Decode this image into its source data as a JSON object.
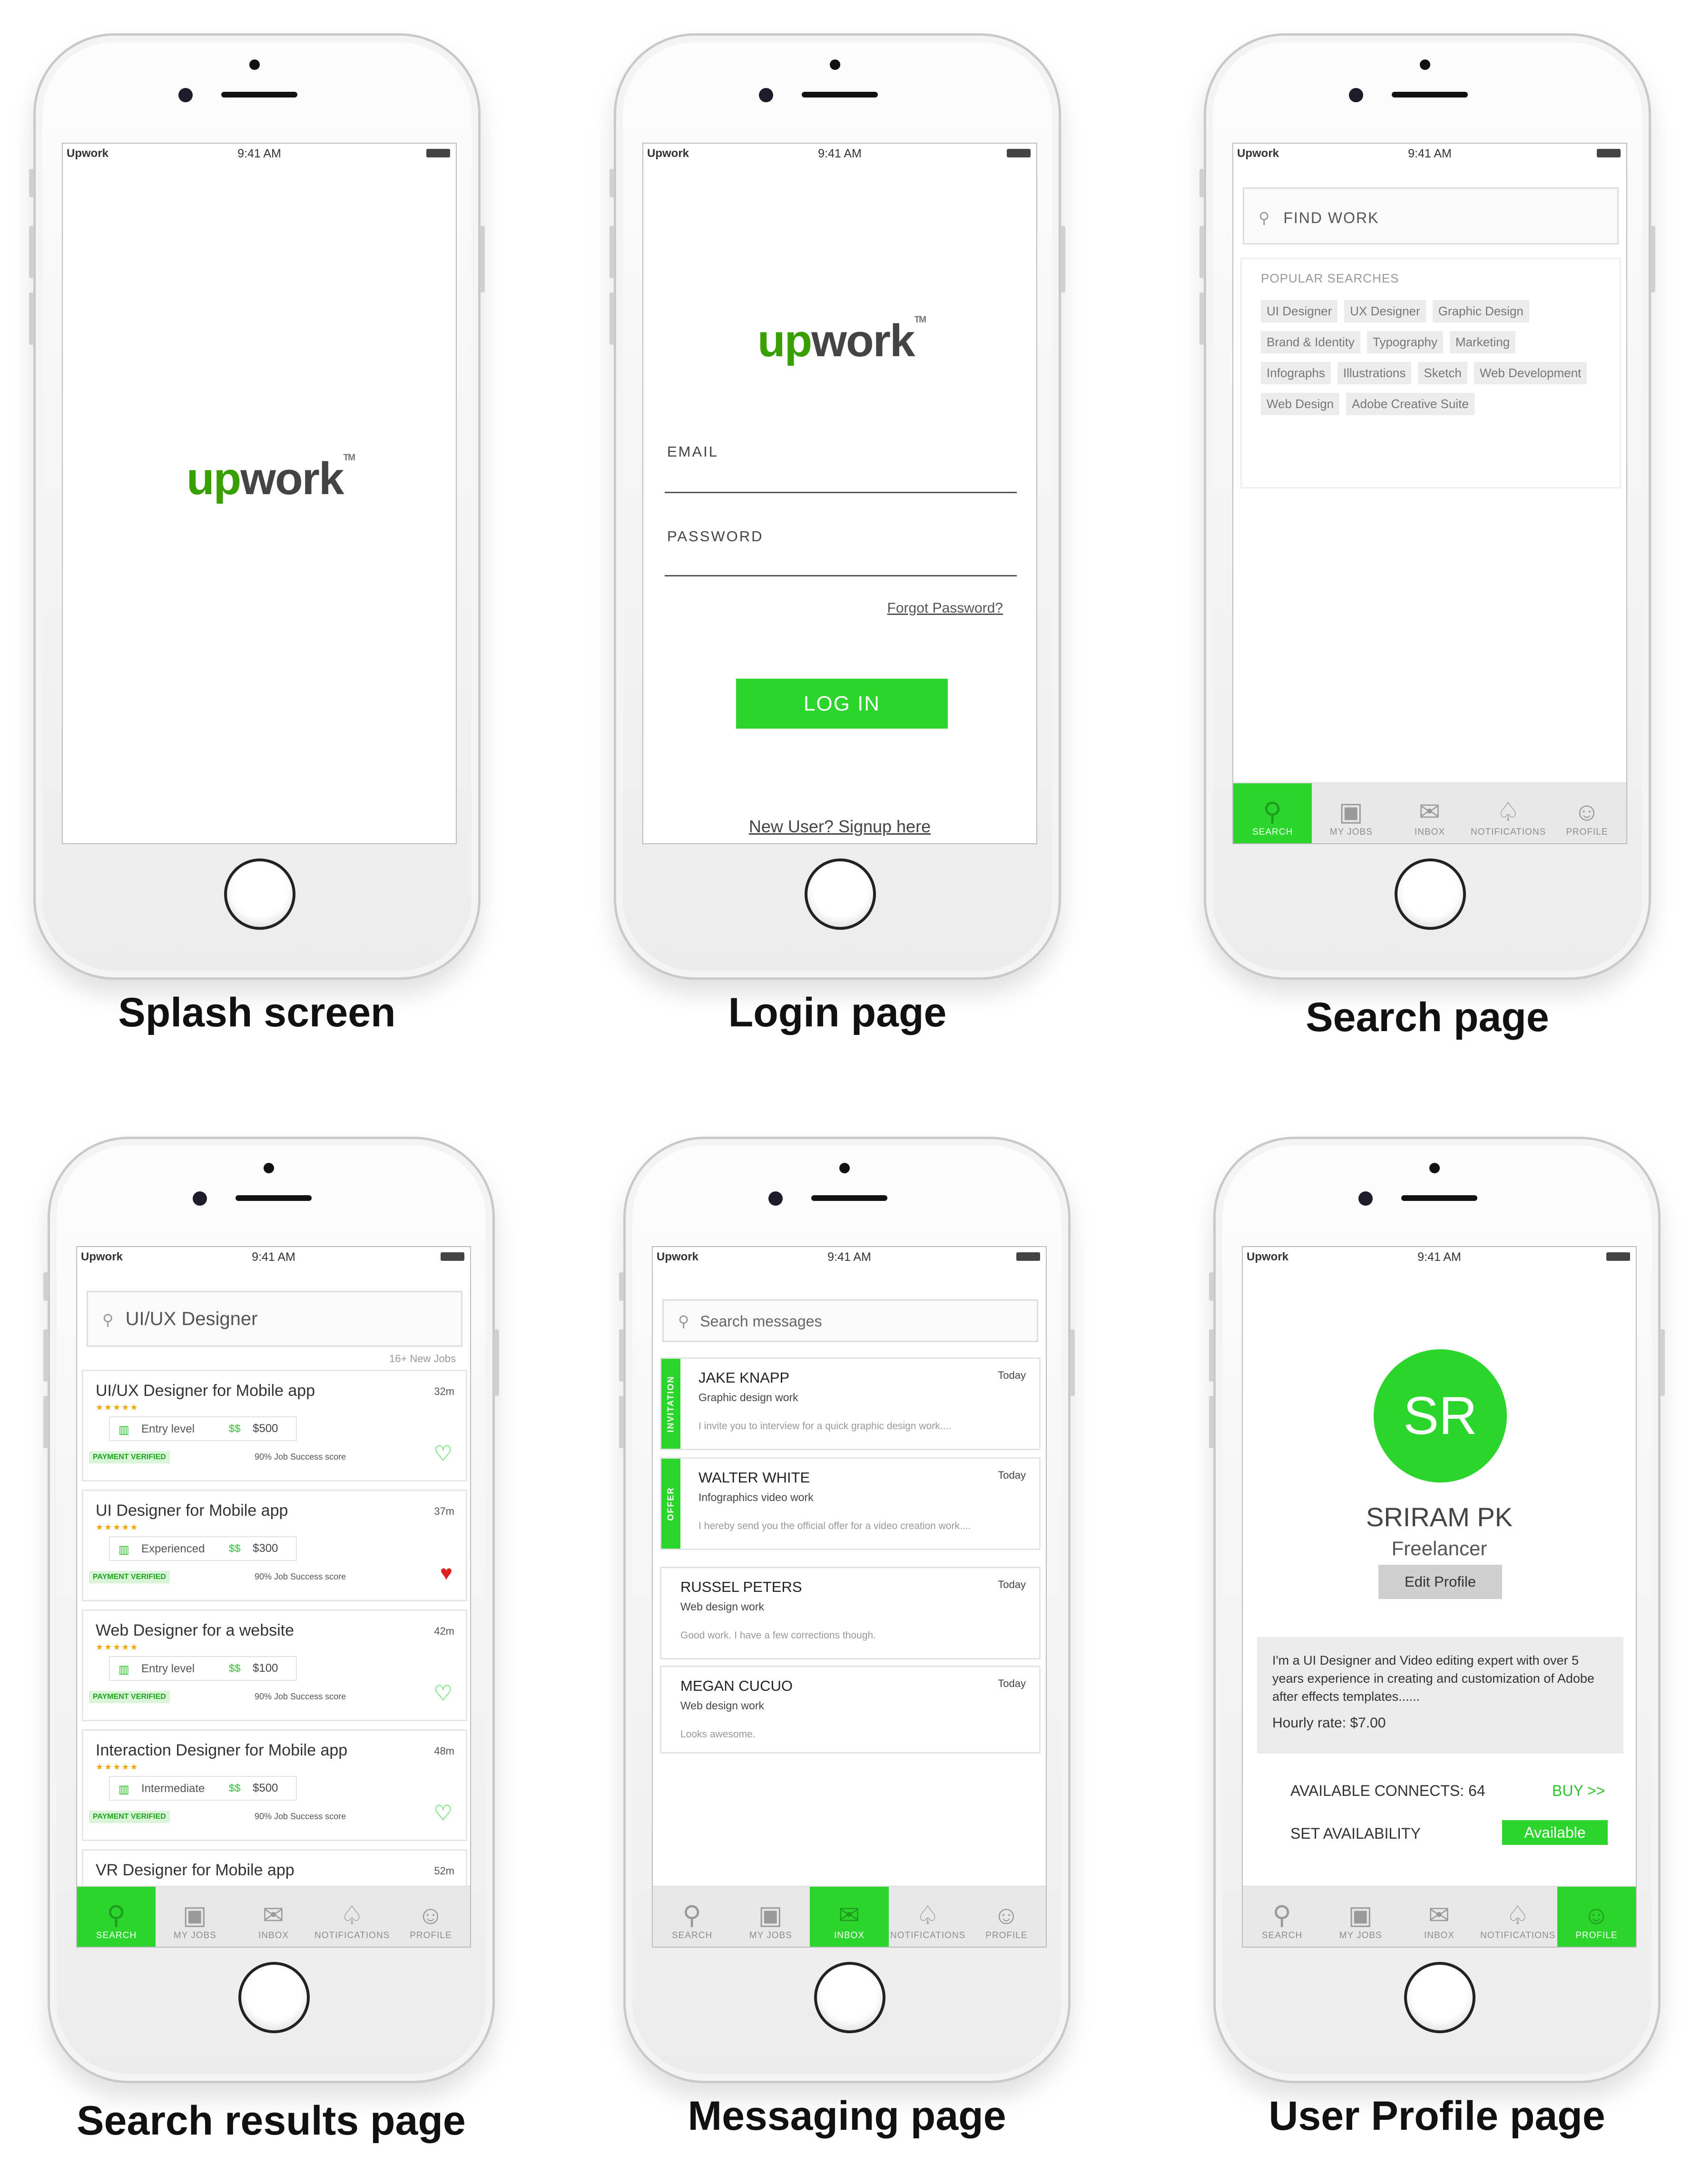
{
  "status": {
    "carrier": "Upwork",
    "time": "9:41 AM"
  },
  "logo": {
    "up": "up",
    "work": "work",
    "tm": "TM"
  },
  "tabs": {
    "search": "SEARCH",
    "jobs": "MY JOBS",
    "inbox": "INBOX",
    "notifications": "NOTIFICATIONS",
    "profile": "PROFILE"
  },
  "icons": {
    "search": "search-icon",
    "jobs": "briefcase-icon",
    "inbox": "envelope-icon",
    "notifications": "bell-icon",
    "profile": "user-icon",
    "heart": "heart-icon"
  },
  "colors": {
    "accent": "#2cd52b",
    "brand": "#37a000",
    "star": "#f0a800",
    "liked": "#e02020"
  },
  "captions": [
    "Splash screen",
    "Login page",
    "Search page",
    "Search results page",
    "Messaging page",
    "User Profile page"
  ],
  "login": {
    "email_label": "EMAIL",
    "password_label": "PASSWORD",
    "forgot": "Forgot Password?",
    "login_btn": "LOG IN",
    "signup": "New User? Signup here"
  },
  "search": {
    "placeholder": "FIND WORK",
    "popular_title": "POPULAR SEARCHES",
    "chips": [
      "UI Designer",
      "UX Designer",
      "Graphic Design",
      "Brand & Identity",
      "Typography",
      "Marketing",
      "Infographs",
      "Illustrations",
      "Sketch",
      "Web Development",
      "Web Design",
      "Adobe Creative Suite"
    ]
  },
  "results": {
    "query": "UI/UX Designer",
    "count": "16+ New Jobs",
    "payment": "PAYMENT VERIFIED",
    "score": "90% Job Success score",
    "currency": "$$",
    "jobs": [
      {
        "title": "UI/UX Designer for Mobile app",
        "time": "32m",
        "stars": "★★★★★",
        "level": "Entry level",
        "price": "$500",
        "liked": false
      },
      {
        "title": "UI Designer for Mobile app",
        "time": "37m",
        "stars": "★★★★★",
        "level": "Experienced",
        "price": "$300",
        "liked": true
      },
      {
        "title": "Web Designer for a website",
        "time": "42m",
        "stars": "★★★★★",
        "level": "Entry level",
        "price": "$100",
        "liked": false
      },
      {
        "title": "Interaction Designer for Mobile app",
        "time": "48m",
        "stars": "★★★★★",
        "level": "Intermediate",
        "price": "$500",
        "liked": false
      },
      {
        "title": "VR Designer for Mobile app",
        "time": "52m"
      }
    ]
  },
  "messaging": {
    "placeholder": "Search messages",
    "messages": [
      {
        "tag": "INVITATION",
        "name": "JAKE KNAPP",
        "subject": "Graphic design work",
        "preview": "I invite you to interview for a quick graphic design work....",
        "date": "Today"
      },
      {
        "tag": "OFFER",
        "name": "WALTER WHITE",
        "subject": "Infographics video work",
        "preview": "I hereby send you the official offer for a video creation work....",
        "date": "Today"
      },
      {
        "tag": "",
        "name": "RUSSEL PETERS",
        "subject": "Web design work",
        "preview": "Good work. I have a few corrections though.",
        "date": "Today"
      },
      {
        "tag": "",
        "name": "MEGAN CUCUO",
        "subject": "Web design work",
        "preview": "Looks awesome.",
        "date": "Today"
      }
    ]
  },
  "profile": {
    "initials": "SR",
    "name": "SRIRAM PK",
    "role": "Freelancer",
    "edit_btn": "Edit Profile",
    "bio": "I'm a UI Designer and Video editing expert with over 5 years experience in creating and customization of Adobe after effects templates......",
    "rate": "Hourly rate: $7.00",
    "connects": "AVAILABLE CONNECTS: 64",
    "buy": "BUY >>",
    "availability_label": "SET AVAILABILITY",
    "availability": "Available"
  }
}
